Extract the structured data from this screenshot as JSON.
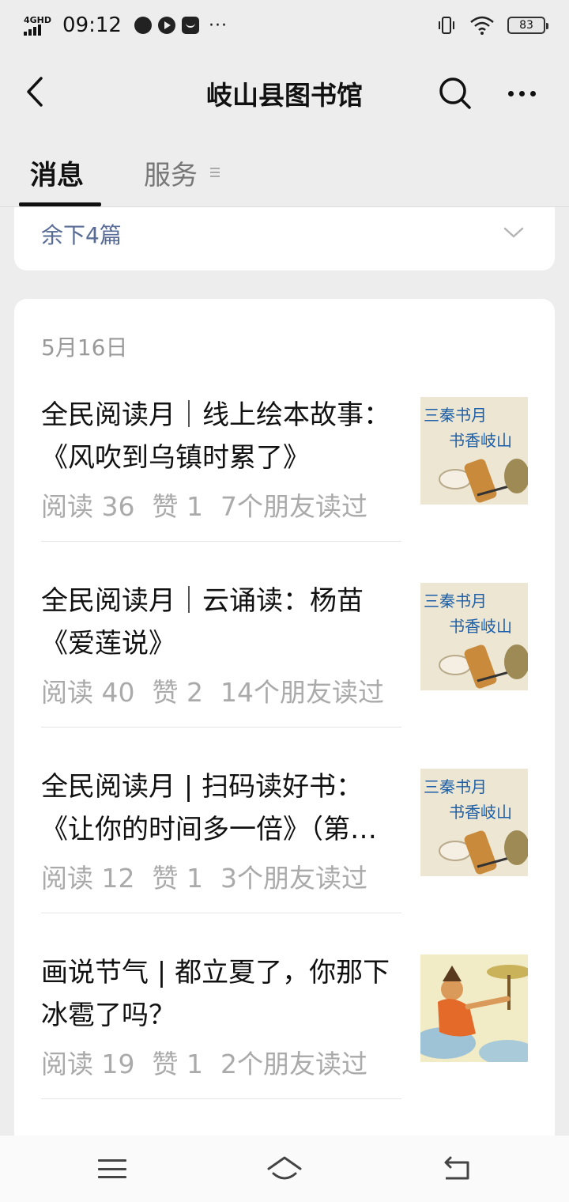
{
  "status_bar": {
    "network": "4GHD",
    "time": "09:12",
    "more": "···",
    "battery": "83"
  },
  "nav": {
    "title": "岐山县图书馆"
  },
  "tabs": [
    {
      "label": "消息",
      "active": true
    },
    {
      "label": "服务",
      "active": false
    }
  ],
  "previous_card": {
    "remaining_label": "余下4篇"
  },
  "main_card": {
    "date": "5月16日",
    "articles": [
      {
        "title": "全民阅读月｜线上绘本故事：《风吹到乌镇时累了》",
        "reads": "阅读 36",
        "likes": "赞 1",
        "friends": "7个朋友读过"
      },
      {
        "title": "全民阅读月｜云诵读：杨苗《爱莲说》",
        "reads": "阅读 40",
        "likes": "赞 2",
        "friends": "14个朋友读过"
      },
      {
        "title": "全民阅读月 | 扫码读好书：《让你的时间多一倍》（第一期）",
        "reads": "阅读 12",
        "likes": "赞 1",
        "friends": "3个朋友读过"
      },
      {
        "title": "画说节气 | 都立夏了，你那下冰雹了吗？",
        "reads": "阅读 19",
        "likes": "赞 1",
        "friends": "2个朋友读过"
      }
    ],
    "thumb_text": [
      "三秦书月",
      "书香岐山"
    ]
  },
  "colors": {
    "link": "#576b95",
    "meta": "#aaaaaa",
    "background": "#ededed"
  }
}
